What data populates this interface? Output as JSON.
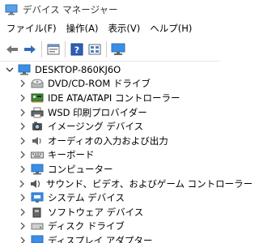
{
  "window": {
    "title": "デバイス マネージャー"
  },
  "menu": [
    {
      "label": "ファイル(F)"
    },
    {
      "label": "操作(A)"
    },
    {
      "label": "表示(V)"
    },
    {
      "label": "ヘルプ(H)"
    }
  ],
  "toolbar": [
    "back-arrow-icon",
    "forward-arrow-icon",
    "properties-icon",
    "help-icon",
    "view-icon",
    "monitor-icon"
  ],
  "tree": {
    "root": {
      "label": "DESKTOP-860KJ6O",
      "expanded": true
    },
    "items": [
      {
        "label": "DVD/CD-ROM ドライブ",
        "icon": "cd-drive-icon"
      },
      {
        "label": "IDE ATA/ATAPI コントローラー",
        "icon": "ide-controller-icon"
      },
      {
        "label": "WSD 印刷プロバイダー",
        "icon": "printer-icon"
      },
      {
        "label": "イメージング デバイス",
        "icon": "camera-icon"
      },
      {
        "label": "オーディオの入力および出力",
        "icon": "speaker-icon"
      },
      {
        "label": "キーボード",
        "icon": "keyboard-icon"
      },
      {
        "label": "コンピューター",
        "icon": "computer-icon"
      },
      {
        "label": "サウンド、ビデオ、およびゲーム コントローラー",
        "icon": "sound-icon"
      },
      {
        "label": "システム デバイス",
        "icon": "system-devices-icon"
      },
      {
        "label": "ソフトウェア デバイス",
        "icon": "software-devices-icon"
      },
      {
        "label": "ディスク ドライブ",
        "icon": "disk-drive-icon"
      },
      {
        "label": "ディスプレイ アダプター",
        "icon": "display-adapter-icon"
      }
    ]
  }
}
